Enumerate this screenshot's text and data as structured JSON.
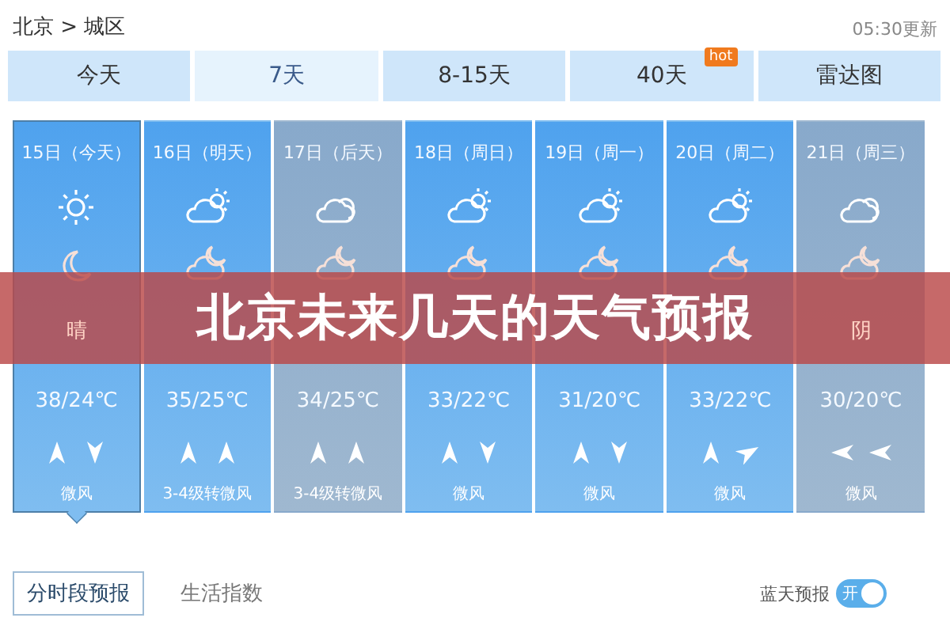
{
  "header": {
    "breadcrumb": "北京 > 城区",
    "updated": "05:30更新"
  },
  "tabs": [
    {
      "label": "今天",
      "selected": false
    },
    {
      "label": "7天",
      "selected": true
    },
    {
      "label": "8-15天",
      "selected": false
    },
    {
      "label": "40天",
      "selected": false,
      "badge": "hot"
    },
    {
      "label": "雷达图",
      "selected": false
    }
  ],
  "days": [
    {
      "date": "15日（今天）",
      "selected": true,
      "kind": "clear",
      "icons": [
        {
          "kind": "sun"
        },
        {
          "kind": "moon"
        }
      ],
      "condition": "晴",
      "temp": "38/24℃",
      "arrows": [
        {
          "kind": "n"
        },
        {
          "kind": "s"
        }
      ],
      "wind": "微风"
    },
    {
      "date": "16日（明天）",
      "selected": false,
      "kind": "clear",
      "icons": [
        {
          "kind": "partly"
        },
        {
          "kind": "mooncloud"
        }
      ],
      "temp": "35/25℃",
      "arrows": [
        {
          "kind": "n"
        },
        {
          "kind": "n"
        }
      ],
      "wind": "3-4级转微风"
    },
    {
      "date": "17日（后天）",
      "selected": false,
      "kind": "overcast",
      "icons": [
        {
          "kind": "cloudy"
        },
        {
          "kind": "mooncloud"
        }
      ],
      "temp": "34/25℃",
      "arrows": [
        {
          "kind": "n"
        },
        {
          "kind": "n"
        }
      ],
      "wind": "3-4级转微风"
    },
    {
      "date": "18日（周日）",
      "selected": false,
      "kind": "clear",
      "icons": [
        {
          "kind": "partly"
        },
        {
          "kind": "mooncloud"
        }
      ],
      "temp": "33/22℃",
      "arrows": [
        {
          "kind": "n"
        },
        {
          "kind": "s"
        }
      ],
      "wind": "微风"
    },
    {
      "date": "19日（周一）",
      "selected": false,
      "kind": "clear",
      "icons": [
        {
          "kind": "partly"
        },
        {
          "kind": "mooncloud"
        }
      ],
      "temp": "31/20℃",
      "arrows": [
        {
          "kind": "n"
        },
        {
          "kind": "s"
        }
      ],
      "wind": "微风"
    },
    {
      "date": "20日（周二）",
      "selected": false,
      "kind": "clear",
      "icons": [
        {
          "kind": "partly"
        },
        {
          "kind": "mooncloud"
        }
      ],
      "temp": "33/22℃",
      "arrows": [
        {
          "kind": "n"
        },
        {
          "kind": "ne"
        }
      ],
      "wind": "微风"
    },
    {
      "date": "21日（周三）",
      "selected": false,
      "kind": "overcast",
      "icons": [
        {
          "kind": "cloudy"
        },
        {
          "kind": "mooncloud"
        }
      ],
      "condition": "阴",
      "temp": "30/20℃",
      "arrows": [
        {
          "kind": "w"
        },
        {
          "kind": "w"
        }
      ],
      "wind": "微风"
    }
  ],
  "banner": "北京未来几天的天气预报",
  "subtabs": [
    {
      "label": "分时段预报",
      "selected": true
    },
    {
      "label": "生活指数",
      "selected": false
    }
  ],
  "blue_sky": {
    "label": "蓝天预报",
    "toggle": "开",
    "on": true
  }
}
